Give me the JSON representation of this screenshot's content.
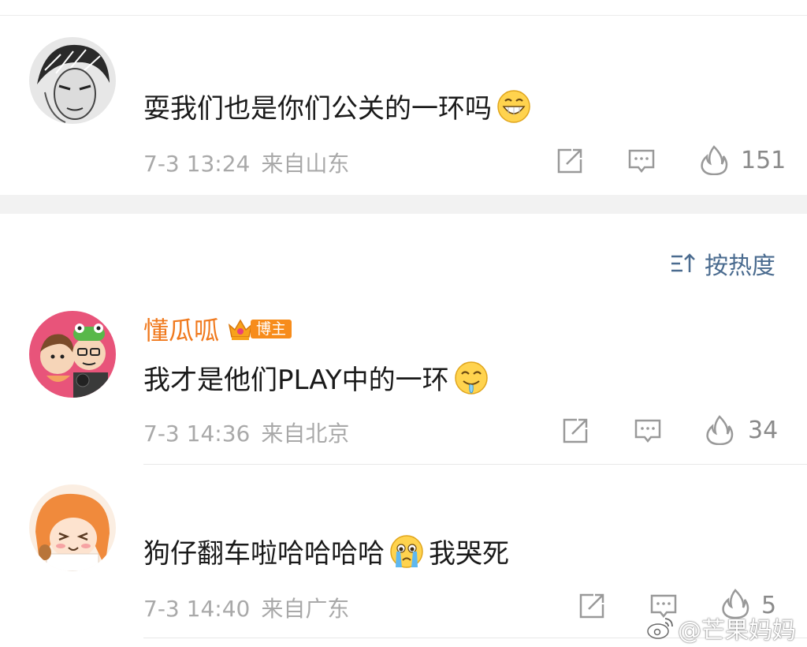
{
  "comments": [
    {
      "text": "耍我们也是你们公关的一环吗",
      "emoji": "grinning-emoji",
      "time": "7-3 13:24",
      "source": "来自山东",
      "likes": "151"
    },
    {
      "username": "懂瓜呱",
      "badge": "博主",
      "text": "我才是他们PLAY中的一环",
      "emoji": "drooling-emoji",
      "time": "7-3 14:36",
      "source": "来自北京",
      "likes": "34"
    },
    {
      "text": "狗仔翻车啦哈哈哈哈",
      "emoji": "crying-emoji",
      "text_after": "我哭死",
      "time": "7-3 14:40",
      "source": "来自广东",
      "likes": "5"
    }
  ],
  "sort": {
    "label": "按热度",
    "icon": "sort-icon"
  },
  "watermark": {
    "text": "@芒果妈妈",
    "icon": "weibo-logo"
  },
  "colors": {
    "username": "#f0791d",
    "badge": "#f78c1b",
    "sort": "#4a6b8f",
    "meta": "#a9a9a9"
  }
}
